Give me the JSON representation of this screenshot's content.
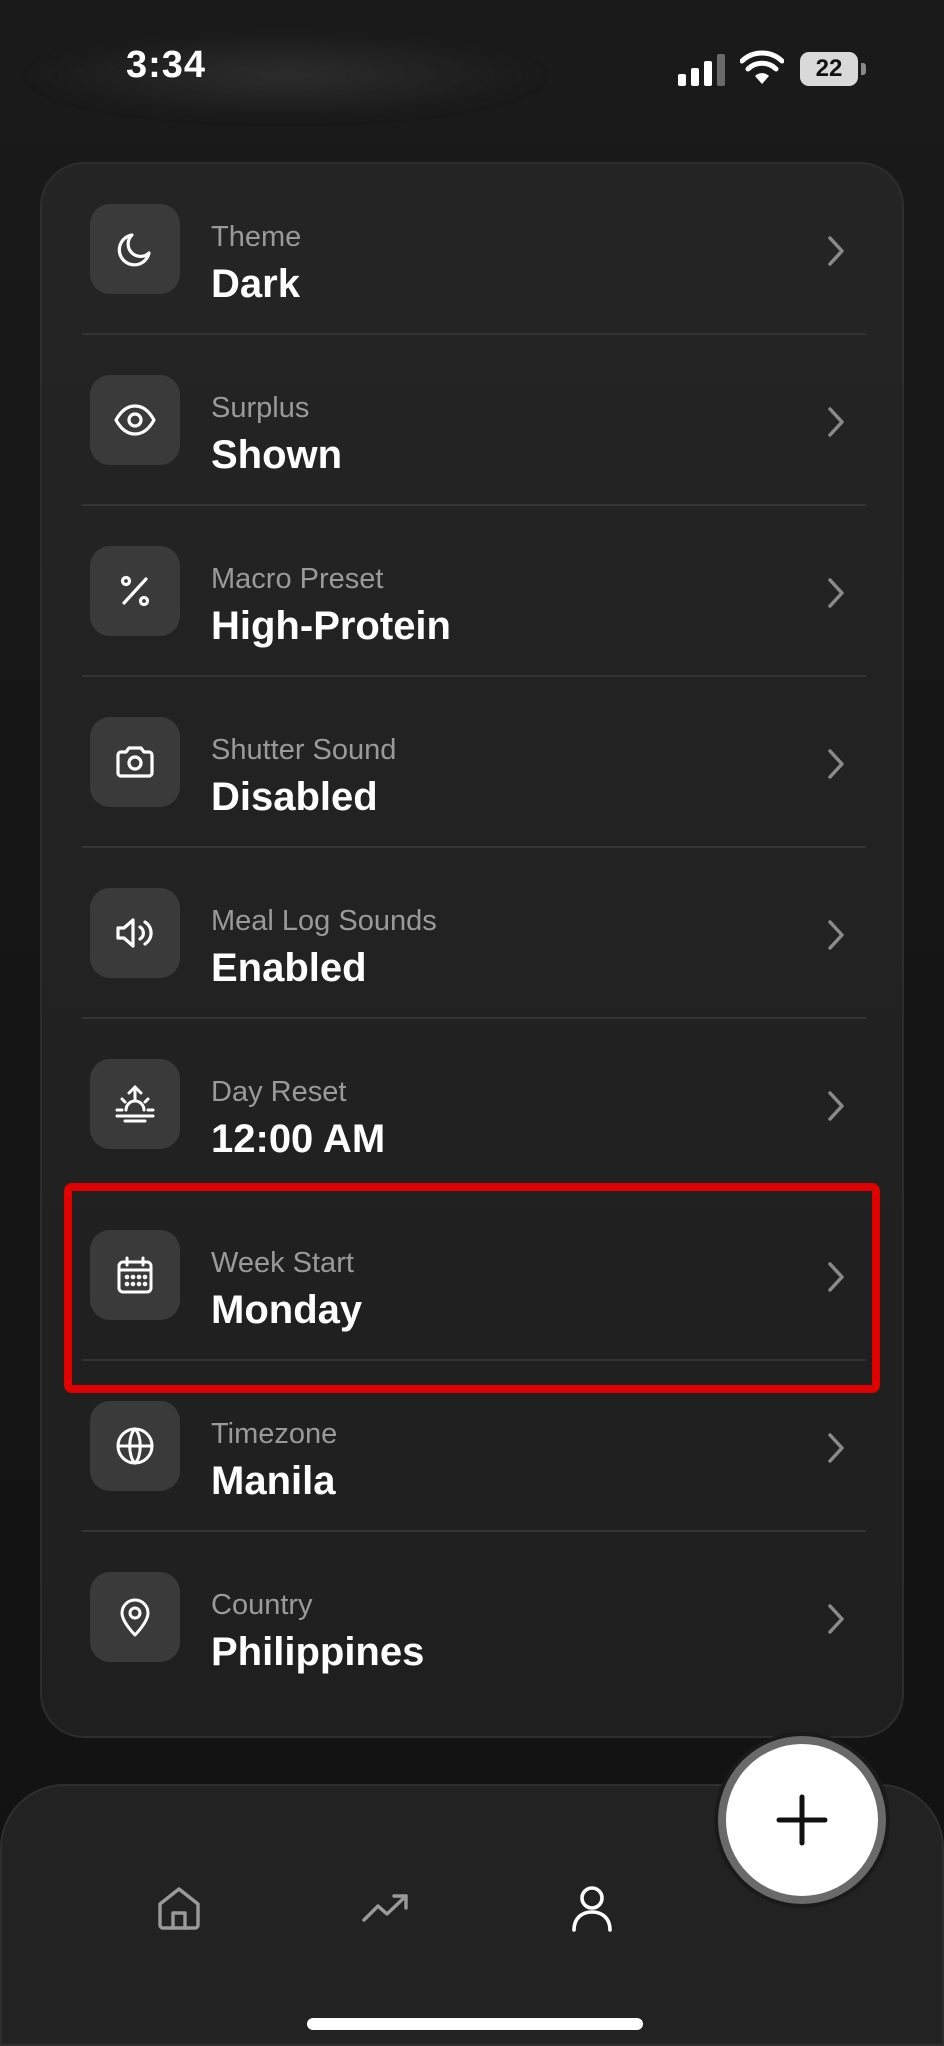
{
  "status_bar": {
    "time": "3:34",
    "battery_level": "22"
  },
  "settings": {
    "rows": [
      {
        "label": "Theme",
        "value": "Dark",
        "icon": "moon-icon"
      },
      {
        "label": "Surplus",
        "value": "Shown",
        "icon": "eye-icon"
      },
      {
        "label": "Macro Preset",
        "value": "High-Protein",
        "icon": "percent-icon"
      },
      {
        "label": "Shutter Sound",
        "value": "Disabled",
        "icon": "camera-icon"
      },
      {
        "label": "Meal Log Sounds",
        "value": "Enabled",
        "icon": "speaker-icon"
      },
      {
        "label": "Day Reset",
        "value": "12:00 AM",
        "icon": "sunrise-icon"
      },
      {
        "label": "Week Start",
        "value": "Monday",
        "icon": "calendar-icon"
      },
      {
        "label": "Timezone",
        "value": "Manila",
        "icon": "globe-icon"
      },
      {
        "label": "Country",
        "value": "Philippines",
        "icon": "location-pin-icon"
      }
    ],
    "highlighted_row": "Week Start"
  },
  "nav": {
    "items": [
      {
        "icon": "home-icon"
      },
      {
        "icon": "trending-up-icon"
      },
      {
        "icon": "user-icon",
        "active": true
      }
    ],
    "fab_icon": "plus-icon"
  },
  "colors": {
    "background": "#151515",
    "card": "#222222",
    "icon_tile": "#3a3a3a",
    "label": "#9a9a9a",
    "value": "#ffffff",
    "highlight": "#e00000"
  }
}
